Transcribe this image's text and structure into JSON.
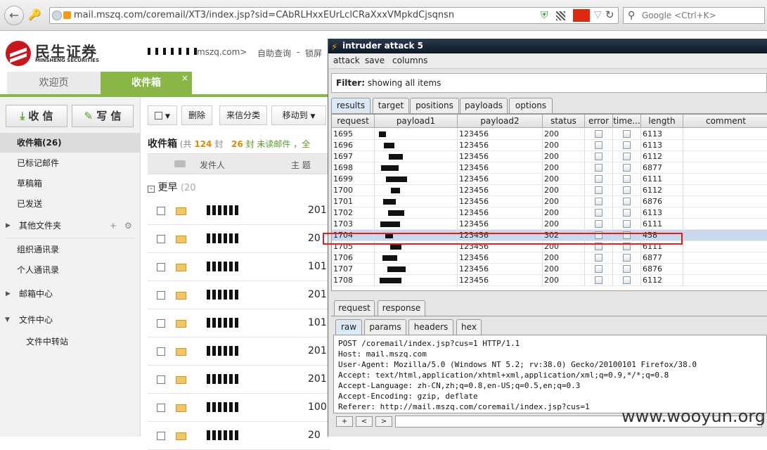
{
  "browser": {
    "url": "mail.mszq.com/coremail/XT3/index.jsp?sid=CAbRLHxxEUrLclCRaXxxVMpkdCjsqnsn",
    "search_placeholder": "Google <Ctrl+K>"
  },
  "mail": {
    "logo_cn": "民生证券",
    "logo_en": "MINSHENG SECURITIES",
    "user_email": "mszq.com>",
    "header_links": [
      "自助查询",
      "锁屏"
    ],
    "tabs": [
      "欢迎页",
      "收件箱"
    ],
    "receive_btn": "收 信",
    "compose_btn": "写 信",
    "folders": [
      {
        "label": "收件箱(26)"
      },
      {
        "label": "已标记邮件"
      },
      {
        "label": "草稿箱"
      },
      {
        "label": "已发送"
      },
      {
        "label": "其他文件夹"
      },
      {
        "label": "组织通讯录"
      },
      {
        "label": "个人通讯录"
      },
      {
        "label": "邮箱中心"
      },
      {
        "label": "文件中心"
      },
      {
        "label": "文件中转站"
      }
    ],
    "toolbar": {
      "delete": "删除",
      "categorize": "来信分类",
      "move_to": "移动到"
    },
    "inbox_title": "收件箱",
    "inbox_summary": {
      "prefix": "(共",
      "total": "124",
      "unit": "封",
      "unread": "26",
      "unread_label": "封 未读邮件",
      "all": "，全"
    },
    "columns": {
      "sender": "发件人",
      "subject": "主 题"
    },
    "group_label": "更早",
    "group_count": "(20",
    "row_dates": [
      "201",
      "20",
      "101",
      "201",
      "101",
      "201",
      "201",
      "100",
      "20"
    ]
  },
  "intruder": {
    "title": "intruder attack 5",
    "menu": [
      "attack",
      "save",
      "columns"
    ],
    "filter_label": "Filter:",
    "filter_text": "showing all items",
    "tabs": [
      "results",
      "target",
      "positions",
      "payloads",
      "options"
    ],
    "grid_headers": [
      "request",
      "payload1",
      "payload2",
      "status",
      "error",
      "time...",
      "length",
      "comment"
    ],
    "rows": [
      {
        "request": "1695",
        "payload2": "123456",
        "status": "200",
        "length": "6113"
      },
      {
        "request": "1696",
        "payload2": "123456",
        "status": "200",
        "length": "6113"
      },
      {
        "request": "1697",
        "payload2": "123456",
        "status": "200",
        "length": "6112"
      },
      {
        "request": "1698",
        "payload2": "123456",
        "status": "200",
        "length": "6877"
      },
      {
        "request": "1699",
        "payload2": "123456",
        "status": "200",
        "length": "6111"
      },
      {
        "request": "1700",
        "payload2": "123456",
        "status": "200",
        "length": "6112"
      },
      {
        "request": "1701",
        "payload2": "123456",
        "status": "200",
        "length": "6876"
      },
      {
        "request": "1702",
        "payload2": "123456",
        "status": "200",
        "length": "6113"
      },
      {
        "request": "1703",
        "payload2": "123456",
        "status": "200",
        "length": "6111"
      },
      {
        "request": "1704",
        "payload2": "123456",
        "status": "302",
        "length": "458"
      },
      {
        "request": "1705",
        "payload2": "123456",
        "status": "200",
        "length": "6111"
      },
      {
        "request": "1706",
        "payload2": "123456",
        "status": "200",
        "length": "6877"
      },
      {
        "request": "1707",
        "payload2": "123456",
        "status": "200",
        "length": "6876"
      },
      {
        "request": "1708",
        "payload2": "123456",
        "status": "200",
        "length": "6112"
      }
    ],
    "req_tabs": [
      "request",
      "response"
    ],
    "sub_tabs": [
      "raw",
      "params",
      "headers",
      "hex"
    ],
    "raw_lines": [
      "POST /coremail/index.jsp?cus=1 HTTP/1.1",
      "Host: mail.mszq.com",
      "User-Agent: Mozilla/5.0 (Windows NT 5.2; rv:38.0) Gecko/20100101 Firefox/38.0",
      "Accept: text/html,application/xhtml+xml,application/xml;q=0.9,*/*;q=0.8",
      "Accept-Language: zh-CN,zh;q=0.8,en-US;q=0.5,en;q=0.3",
      "Accept-Encoding: gzip, deflate",
      "Referer: http://mail.mszq.com/coremail/index.jsp?cus=1"
    ],
    "nav_buttons": [
      "+",
      "<",
      ">"
    ]
  },
  "watermark": "www.wooyun.org"
}
